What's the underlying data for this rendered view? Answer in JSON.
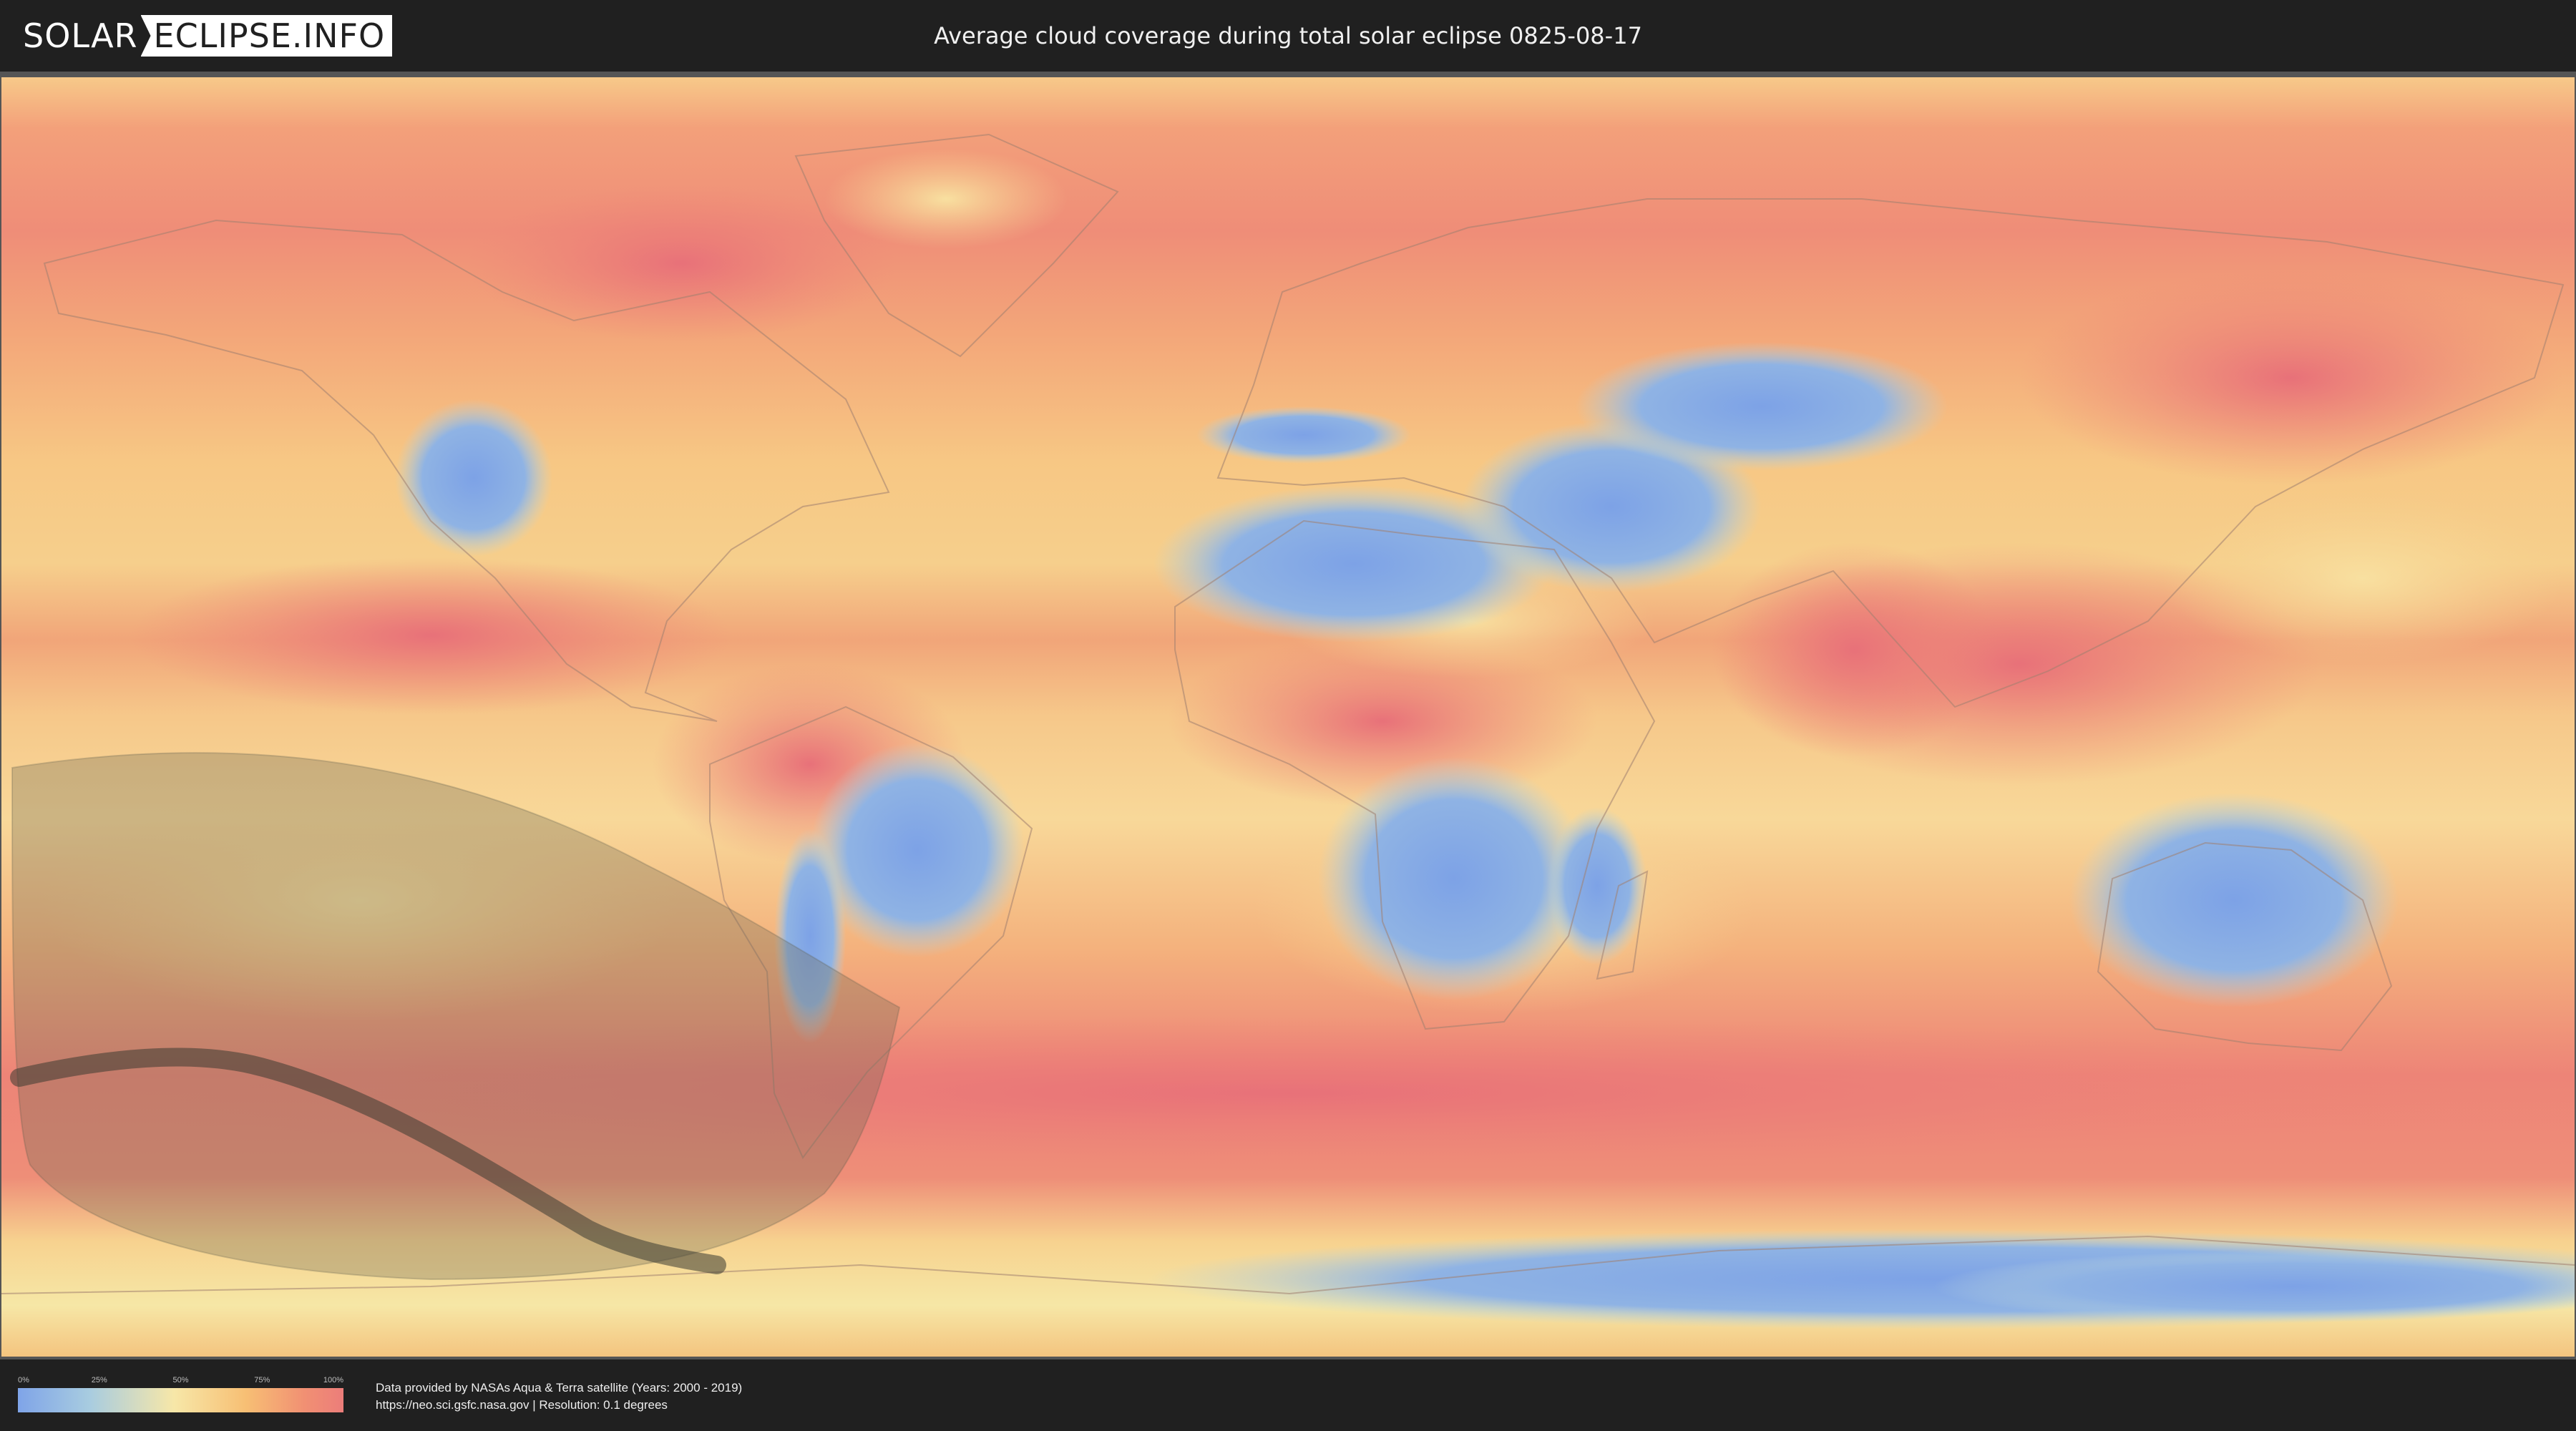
{
  "header": {
    "logo_solar": "SOLAR",
    "logo_eclipse": "ECLIPSE.INFO",
    "title": "Average cloud coverage during total solar eclipse 0825-08-17"
  },
  "map": {
    "layer": "cloud-coverage",
    "colors": {
      "clear": "#7fa4e8",
      "low": "#a8cce0",
      "mid": "#f7e7a8",
      "high": "#f7bf74",
      "overcast": "#ec7d7a",
      "eclipse_shadow": "#5a5a4a",
      "path_of_totality": "#3a3a32"
    }
  },
  "legend": {
    "ticks": [
      "0%",
      "25%",
      "50%",
      "75%",
      "100%"
    ],
    "tick_fractions": [
      0,
      0.25,
      0.5,
      0.75,
      1
    ]
  },
  "footer": {
    "credit_line_1": "Data provided by NASAs Aqua & Terra satellite (Years: 2000 - 2019)",
    "credit_line_2": "https://neo.sci.gsfc.nasa.gov | Resolution: 0.1 degrees"
  }
}
